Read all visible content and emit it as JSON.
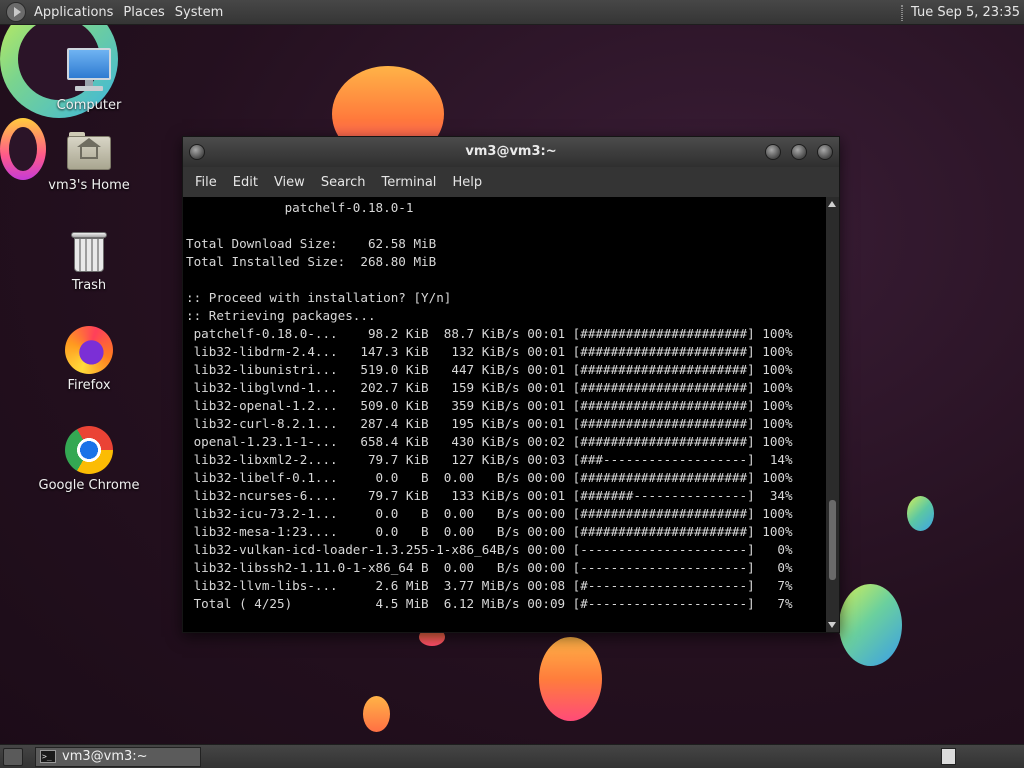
{
  "top_panel": {
    "menus": [
      "Applications",
      "Places",
      "System"
    ],
    "clock": "Tue Sep  5, 23:35"
  },
  "desktop_icons": [
    {
      "label": "Computer",
      "icon": "computer-icon"
    },
    {
      "label": "vm3's Home",
      "icon": "home-folder-icon"
    },
    {
      "label": "Trash",
      "icon": "trash-icon"
    },
    {
      "label": "Firefox",
      "icon": "firefox-icon"
    },
    {
      "label": "Google Chrome",
      "icon": "chrome-icon"
    }
  ],
  "terminal": {
    "title": "vm3@vm3:~",
    "menus": [
      "File",
      "Edit",
      "View",
      "Search",
      "Terminal",
      "Help"
    ],
    "scroll_position": 0.88,
    "lines": [
      "             patchelf-0.18.0-1",
      "",
      "Total Download Size:    62.58 MiB",
      "Total Installed Size:  268.80 MiB",
      "",
      ":: Proceed with installation? [Y/n]",
      ":: Retrieving packages...",
      " patchelf-0.18.0-...    98.2 KiB  88.7 KiB/s 00:01 [######################] 100%",
      " lib32-libdrm-2.4...   147.3 KiB   132 KiB/s 00:01 [######################] 100%",
      " lib32-libunistri...   519.0 KiB   447 KiB/s 00:01 [######################] 100%",
      " lib32-libglvnd-1...   202.7 KiB   159 KiB/s 00:01 [######################] 100%",
      " lib32-openal-1.2...   509.0 KiB   359 KiB/s 00:01 [######################] 100%",
      " lib32-curl-8.2.1...   287.4 KiB   195 KiB/s 00:01 [######################] 100%",
      " openal-1.23.1-1-...   658.4 KiB   430 KiB/s 00:02 [######################] 100%",
      " lib32-libxml2-2....    79.7 KiB   127 KiB/s 00:03 [###-------------------]  14%",
      " lib32-libelf-0.1...     0.0   B  0.00   B/s 00:00 [######################] 100%",
      " lib32-ncurses-6....    79.7 KiB   133 KiB/s 00:01 [#######---------------]  34%",
      " lib32-icu-73.2-1...     0.0   B  0.00   B/s 00:00 [######################] 100%",
      " lib32-mesa-1:23....     0.0   B  0.00   B/s 00:00 [######################] 100%",
      " lib32-vulkan-icd-loader-1.3.255-1-x86_64B/s 00:00 [----------------------]   0%",
      " lib32-libssh2-1.11.0-1-x86_64 B  0.00   B/s 00:00 [----------------------]   0%",
      " lib32-llvm-libs-...     2.6 MiB  3.77 MiB/s 00:08 [#---------------------]   7%",
      " Total ( 4/25)           4.5 MiB  6.12 MiB/s 00:09 [#---------------------]   7%"
    ]
  },
  "bottom_panel": {
    "task_label": "vm3@vm3:~"
  }
}
